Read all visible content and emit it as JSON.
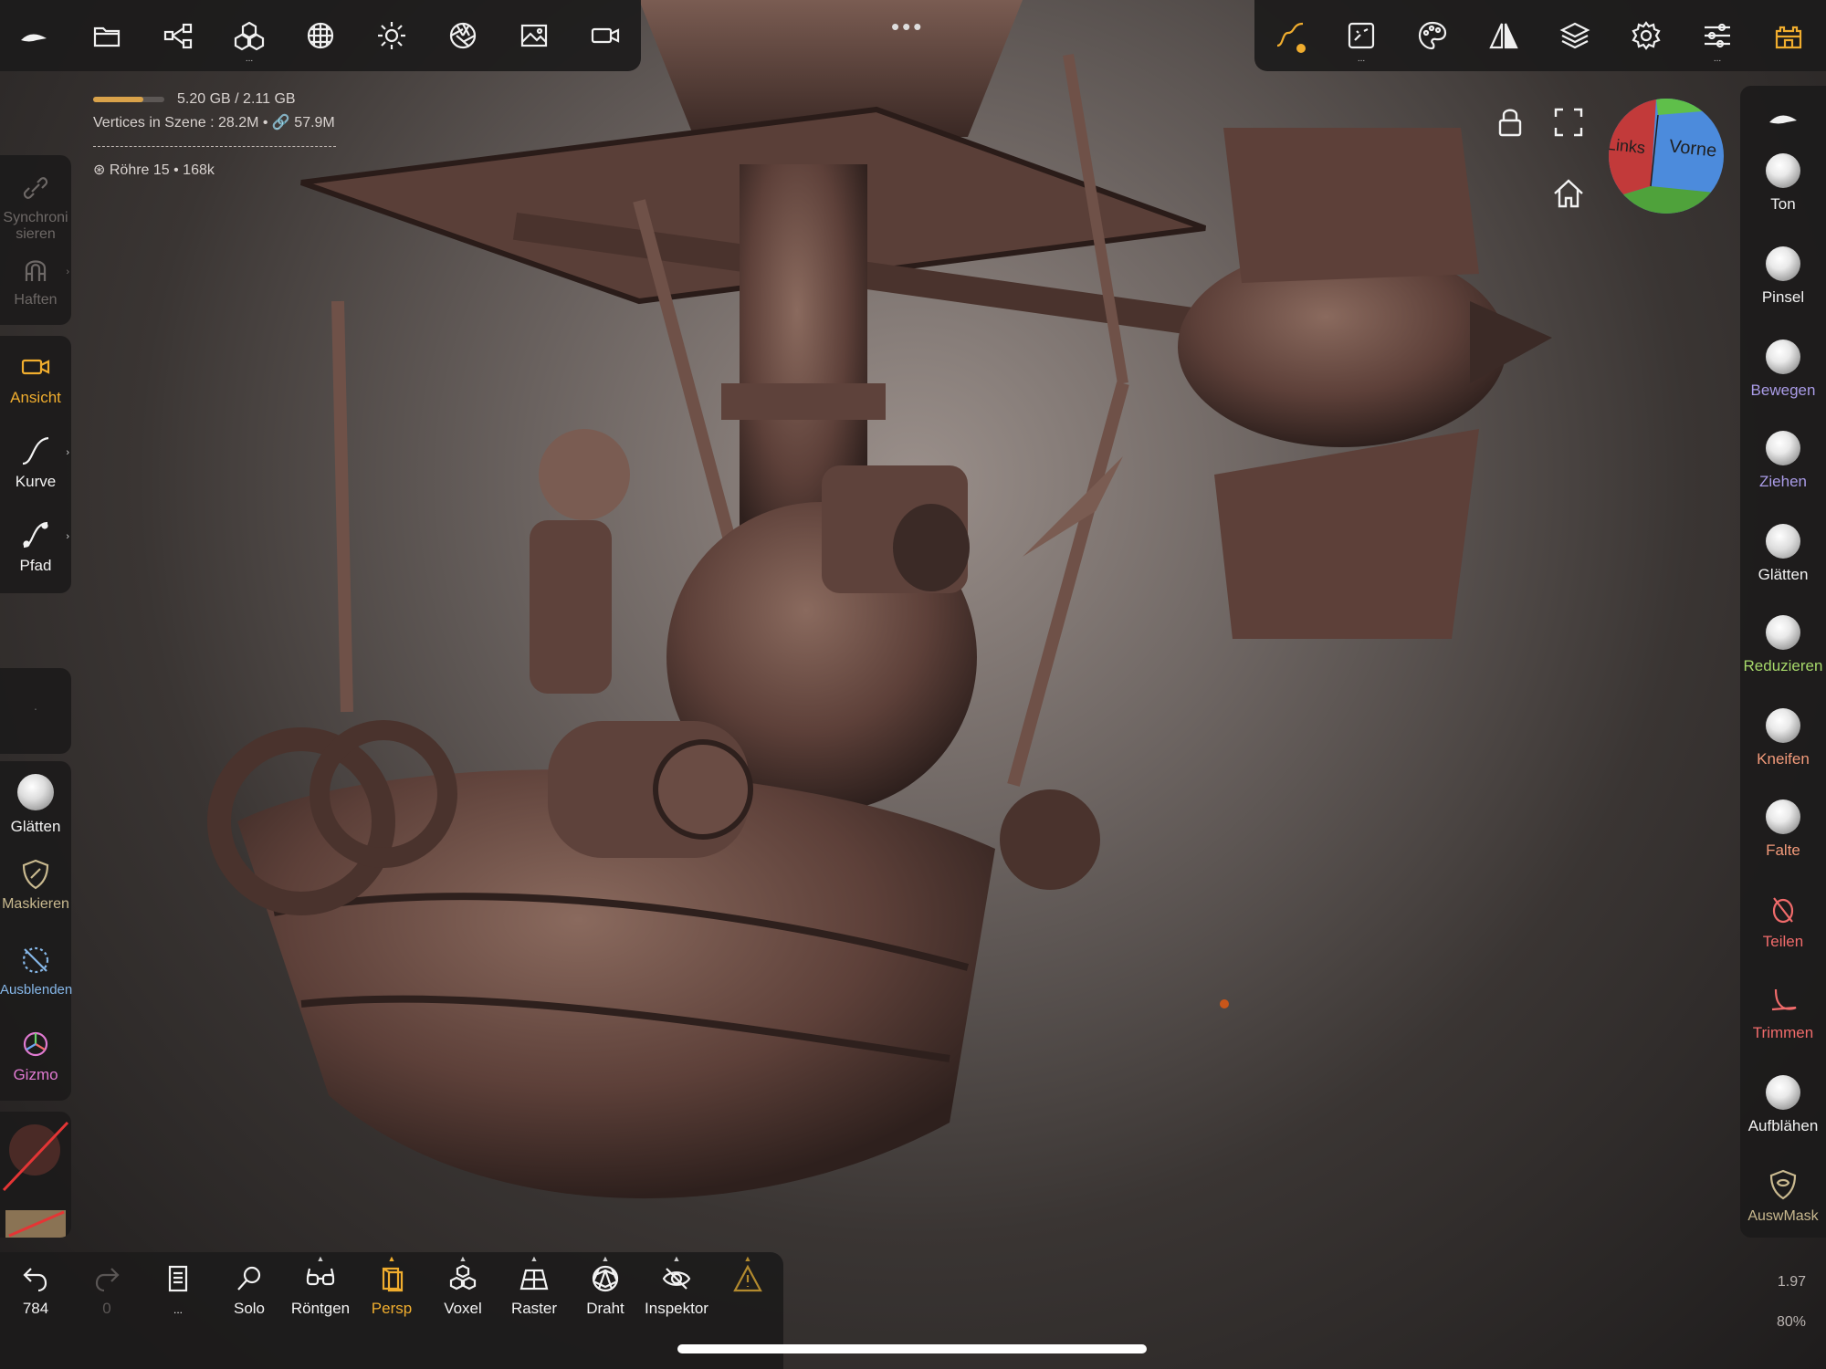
{
  "app": {
    "name": "Nomad Sculpt"
  },
  "top_toolbar": {
    "left": [
      {
        "id": "menu",
        "icon": "nomad-logo-icon"
      },
      {
        "id": "files",
        "icon": "folder-icon"
      },
      {
        "id": "scene",
        "icon": "share-nodes-icon"
      },
      {
        "id": "primitives",
        "icon": "cubes-icon",
        "more": "..."
      },
      {
        "id": "topology",
        "icon": "mesh-sphere-icon"
      },
      {
        "id": "lighting",
        "icon": "sun-icon"
      },
      {
        "id": "postprocess",
        "icon": "aperture-icon"
      },
      {
        "id": "background",
        "icon": "image-icon"
      },
      {
        "id": "camera",
        "icon": "video-camera-icon"
      }
    ],
    "more_dots": "•••",
    "right": [
      {
        "id": "stroke",
        "icon": "stroke-curve-icon"
      },
      {
        "id": "material",
        "icon": "painting-icon",
        "more": "..."
      },
      {
        "id": "palette",
        "icon": "palette-icon"
      },
      {
        "id": "symmetry",
        "icon": "symmetry-icon"
      },
      {
        "id": "layers",
        "icon": "layers-icon"
      },
      {
        "id": "settings",
        "icon": "gear-icon"
      },
      {
        "id": "tools",
        "icon": "sliders-icon",
        "more": "..."
      },
      {
        "id": "interface",
        "icon": "castle-icon"
      }
    ]
  },
  "stats": {
    "memory": "5.20 GB / 2.11 GB",
    "memory_fill": 0.7,
    "vertices": "Vertices in Szene : 28.2M • 🔗 57.9M",
    "object": "Röhre 15 • 168k"
  },
  "left_tools": {
    "group1": [
      {
        "label": "Synchroni sieren",
        "icon": "link-icon",
        "active": false
      },
      {
        "label": "Haften",
        "icon": "magnet-icon",
        "active": false
      }
    ],
    "group2": [
      {
        "label": "Ansicht",
        "icon": "video-camera-icon",
        "active": true
      },
      {
        "label": "Kurve",
        "icon": "curve-icon",
        "active": false
      },
      {
        "label": "Pfad",
        "icon": "path-icon",
        "active": false
      }
    ],
    "group3": [
      {
        "label": "Glätten",
        "icon": "smooth-sphere-icon",
        "color": "#f2f2f2"
      },
      {
        "label": "Maskieren",
        "icon": "mask-shield-icon",
        "color": "#c9b98f"
      },
      {
        "label": "Ausblenden",
        "icon": "hide-mesh-icon",
        "color": "#86b7e8"
      },
      {
        "label": "Gizmo",
        "icon": "gizmo-icon",
        "color": "#e07ad1"
      }
    ]
  },
  "right_tools": [
    {
      "label": "",
      "icon": "nomad-logo-icon",
      "color": "#f2f2f2"
    },
    {
      "label": "Ton",
      "icon": "clay-sphere",
      "color": "#f2f2f2"
    },
    {
      "label": "Pinsel",
      "icon": "brush-sphere",
      "color": "#f2f2f2"
    },
    {
      "label": "Bewegen",
      "icon": "move-sphere",
      "color": "#a99be6"
    },
    {
      "label": "Ziehen",
      "icon": "drag-sphere",
      "color": "#a99be6"
    },
    {
      "label": "Glätten",
      "icon": "smooth-sphere",
      "color": "#f2f2f2"
    },
    {
      "label": "Reduzieren",
      "icon": "flatten-sphere",
      "color": "#a6d86a"
    },
    {
      "label": "Kneifen",
      "icon": "pinch-sphere",
      "color": "#f29a7a"
    },
    {
      "label": "Falte",
      "icon": "crease-sphere",
      "color": "#f29a7a"
    },
    {
      "label": "Teilen",
      "icon": "split-icon",
      "color": "#f06b6b"
    },
    {
      "label": "Trimmen",
      "icon": "trim-icon",
      "color": "#f06b6b"
    },
    {
      "label": "Aufblähen",
      "icon": "inflate-sphere",
      "color": "#f2f2f2"
    },
    {
      "label": "AuswMask",
      "icon": "select-mask-icon",
      "color": "#c9b98f"
    }
  ],
  "viewport_controls": [
    {
      "id": "lock",
      "icon": "lock-icon"
    },
    {
      "id": "fullscreen",
      "icon": "fullscreen-icon"
    },
    {
      "id": "home",
      "icon": "home-icon"
    }
  ],
  "view_cube": {
    "left_label": "Links",
    "front_label": "Vorne"
  },
  "bottom_toolbar": [
    {
      "label": "784",
      "icon": "undo-icon",
      "active": false
    },
    {
      "label": "0",
      "icon": "redo-icon",
      "active": false,
      "disabled": true
    },
    {
      "label": "...",
      "icon": "document-icon",
      "active": false
    },
    {
      "label": "Solo",
      "icon": "search-icon",
      "active": false
    },
    {
      "label": "Röntgen",
      "icon": "glasses-icon",
      "active": false
    },
    {
      "label": "Persp",
      "icon": "perspective-icon",
      "active": true
    },
    {
      "label": "Voxel",
      "icon": "voxel-icon",
      "active": false
    },
    {
      "label": "Raster",
      "icon": "grid-icon",
      "active": false
    },
    {
      "label": "Draht",
      "icon": "wireframe-icon",
      "active": false
    },
    {
      "label": "Inspektor",
      "icon": "eye-icon",
      "active": false
    },
    {
      "label": "",
      "icon": "warning-icon",
      "active": false
    }
  ],
  "corner": {
    "value_top": "1.97",
    "value_bottom": "80%"
  },
  "colors": {
    "accent": "#f0ad2e",
    "panel": "#1c1b1b",
    "purple": "#a99be6",
    "green": "#a6d86a",
    "salmon": "#f29a7a",
    "red": "#f06b6b"
  }
}
